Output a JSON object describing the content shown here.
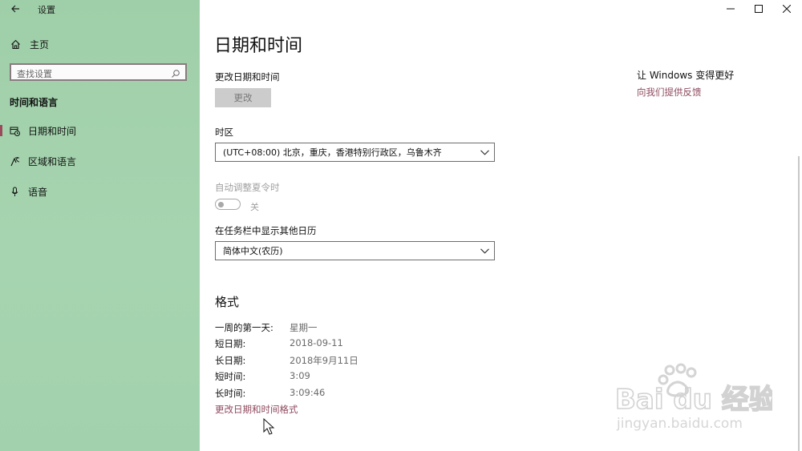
{
  "window": {
    "app_title": "设置",
    "controls": [
      "minimize",
      "maximize",
      "close"
    ]
  },
  "sidebar": {
    "home_label": "主页",
    "search_placeholder": "查找设置",
    "section_title": "时间和语言",
    "items": [
      {
        "label": "日期和时间",
        "icon": "calendar-clock-icon",
        "active": true
      },
      {
        "label": "区域和语言",
        "icon": "region-language-icon",
        "active": false
      },
      {
        "label": "语音",
        "icon": "microphone-icon",
        "active": false
      }
    ]
  },
  "main": {
    "title": "日期和时间",
    "change_datetime_label": "更改日期和时间",
    "change_button": "更改",
    "timezone_label": "时区",
    "timezone_value": "(UTC+08:00) 北京，重庆，香港特别行政区，乌鲁木齐",
    "dst_label": "自动调整夏令时",
    "dst_state": "关",
    "calendar_label": "在任务栏中显示其他日历",
    "calendar_value": "简体中文(农历)",
    "format_title": "格式",
    "formats": [
      {
        "key": "一周的第一天:",
        "value": "星期一"
      },
      {
        "key": "短日期:",
        "value": "2018-09-11"
      },
      {
        "key": "长日期:",
        "value": "2018年9月11日"
      },
      {
        "key": "短时间:",
        "value": "3:09"
      },
      {
        "key": "长时间:",
        "value": "3:09:46"
      }
    ],
    "change_formats_link": "更改日期和时间格式"
  },
  "aside": {
    "title": "让 Windows 变得更好",
    "feedback_link": "向我们提供反馈"
  },
  "watermark": {
    "brand": "Bai du 经验",
    "url": "jingyan.baidu.com"
  },
  "colors": {
    "sidebar_bg": "#a2d2ad",
    "accent": "#9a4a5c",
    "link": "#8e4a5e"
  }
}
